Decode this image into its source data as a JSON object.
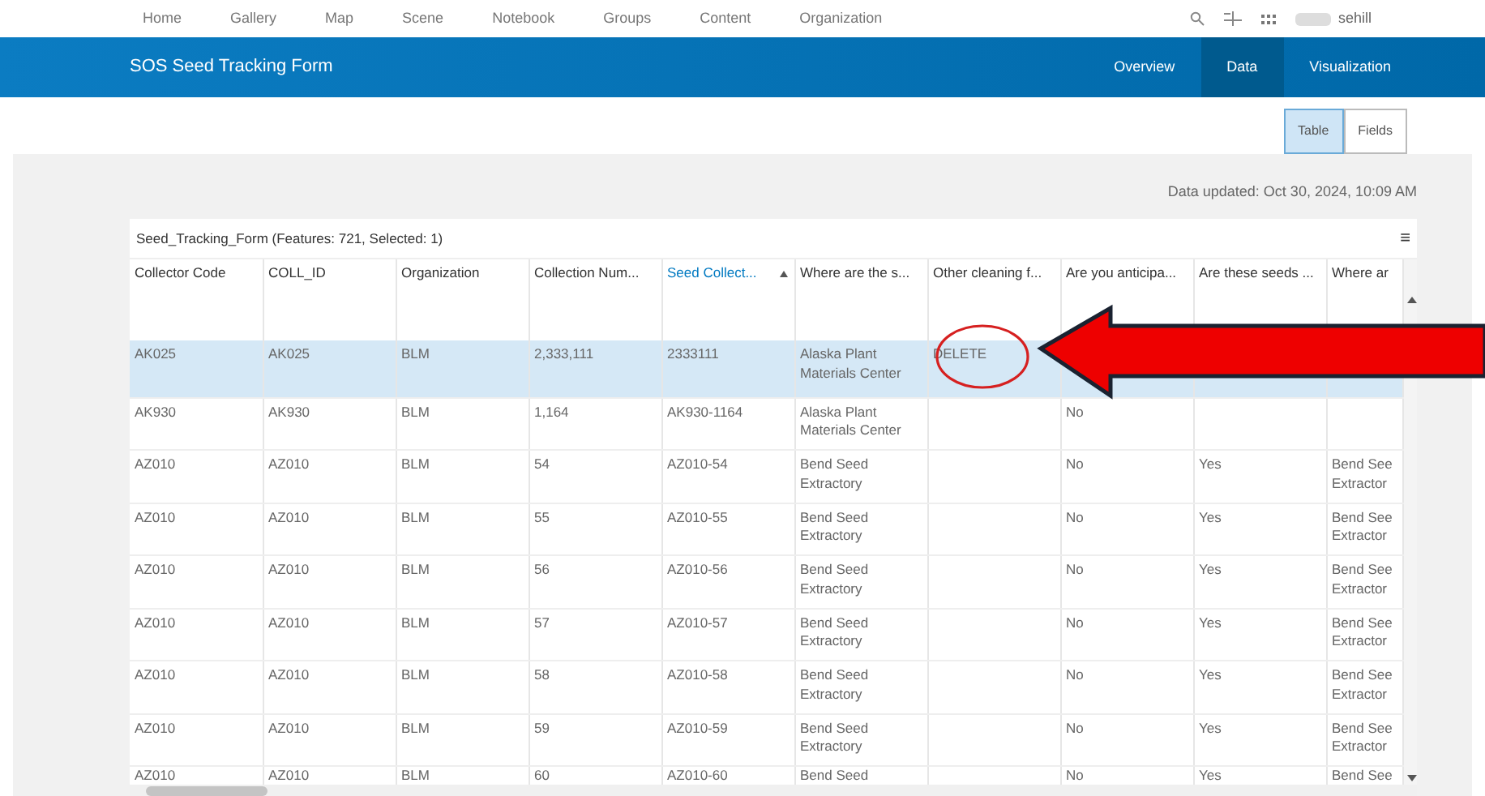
{
  "top_nav": {
    "items": [
      "Home",
      "Gallery",
      "Map",
      "Scene",
      "Notebook",
      "Groups",
      "Content",
      "Organization"
    ],
    "user": "sehill"
  },
  "app_bar": {
    "title": "SOS Seed Tracking Form",
    "tabs": [
      {
        "label": "Overview",
        "selected": false
      },
      {
        "label": "Data",
        "selected": true
      },
      {
        "label": "Visualization",
        "selected": false
      }
    ]
  },
  "view_toggle": [
    {
      "label": "Table",
      "selected": true
    },
    {
      "label": "Fields",
      "selected": false
    }
  ],
  "data_updated": "Data updated: Oct 30, 2024, 10:09 AM",
  "table": {
    "title": "Seed_Tracking_Form (Features: 721, Selected: 1)",
    "menu": "≡",
    "columns": [
      {
        "label": "Collector Code",
        "sorted": false
      },
      {
        "label": "COLL_ID",
        "sorted": false
      },
      {
        "label": "Organization",
        "sorted": false
      },
      {
        "label": "Collection Num...",
        "sorted": false
      },
      {
        "label": "Seed Collect...",
        "sorted": true
      },
      {
        "label": "Where are the s...",
        "sorted": false
      },
      {
        "label": "Other cleaning f...",
        "sorted": false
      },
      {
        "label": "Are you anticipa...",
        "sorted": false
      },
      {
        "label": "Are these seeds ...",
        "sorted": false
      },
      {
        "label": "Where ar",
        "sorted": false
      }
    ],
    "rows": [
      {
        "selected": true,
        "cells": [
          "AK025",
          "AK025",
          "BLM",
          "2,333,111",
          "2333111",
          "Alaska Plant Materials Center",
          "DELETE",
          null,
          null,
          null
        ]
      },
      {
        "selected": false,
        "cells": [
          "AK930",
          "AK930",
          "BLM",
          "1,164",
          "AK930-1164",
          "Alaska Plant Materials Center",
          null,
          "No",
          null,
          null
        ]
      },
      {
        "selected": false,
        "cells": [
          "AZ010",
          "AZ010",
          "BLM",
          "54",
          "AZ010-54",
          "Bend Seed Extractory",
          null,
          "No",
          "Yes",
          "Bend See Extractor"
        ]
      },
      {
        "selected": false,
        "cells": [
          "AZ010",
          "AZ010",
          "BLM",
          "55",
          "AZ010-55",
          "Bend Seed Extractory",
          null,
          "No",
          "Yes",
          "Bend See Extractor"
        ]
      },
      {
        "selected": false,
        "cells": [
          "AZ010",
          "AZ010",
          "BLM",
          "56",
          "AZ010-56",
          "Bend Seed Extractory",
          null,
          "No",
          "Yes",
          "Bend See Extractor"
        ]
      },
      {
        "selected": false,
        "cells": [
          "AZ010",
          "AZ010",
          "BLM",
          "57",
          "AZ010-57",
          "Bend Seed Extractory",
          null,
          "No",
          "Yes",
          "Bend See Extractor"
        ]
      },
      {
        "selected": false,
        "cells": [
          "AZ010",
          "AZ010",
          "BLM",
          "58",
          "AZ010-58",
          "Bend Seed Extractory",
          null,
          "No",
          "Yes",
          "Bend See Extractor"
        ]
      },
      {
        "selected": false,
        "cells": [
          "AZ010",
          "AZ010",
          "BLM",
          "59",
          "AZ010-59",
          "Bend Seed Extractory",
          null,
          "No",
          "Yes",
          "Bend See Extractor"
        ]
      },
      {
        "selected": false,
        "cells": [
          "AZ010",
          "AZ010",
          "BLM",
          "60",
          "AZ010-60",
          "Bend Seed",
          null,
          "No",
          "Yes",
          "Bend See"
        ]
      }
    ]
  }
}
